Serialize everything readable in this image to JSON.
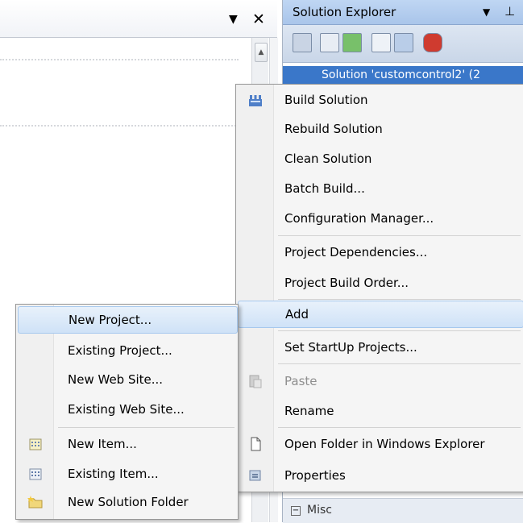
{
  "solution_explorer": {
    "title": "Solution Explorer",
    "tree_root_label": "Solution 'customcontrol2' (2",
    "bottom_section_label": "Misc"
  },
  "context_menu": {
    "items": [
      {
        "label": "Build Solution",
        "icon": "build-solution-icon"
      },
      {
        "label": "Rebuild Solution"
      },
      {
        "label": "Clean Solution"
      },
      {
        "label": "Batch Build..."
      },
      {
        "label": "Configuration Manager..."
      },
      {
        "label": "Project Dependencies..."
      },
      {
        "label": "Project Build Order..."
      },
      {
        "label": "Add",
        "highlighted": true
      },
      {
        "label": "Set StartUp Projects..."
      },
      {
        "label": "Paste",
        "disabled": true,
        "icon": "paste-icon"
      },
      {
        "label": "Rename"
      },
      {
        "label": "Open Folder in Windows Explorer",
        "icon": "open-folder-icon"
      },
      {
        "label": "Properties",
        "icon": "properties-icon"
      }
    ]
  },
  "add_submenu": {
    "items": [
      {
        "label": "New Project...",
        "highlighted": true
      },
      {
        "label": "Existing Project..."
      },
      {
        "label": "New Web Site..."
      },
      {
        "label": "Existing Web Site..."
      },
      {
        "label": "New Item...",
        "icon": "new-item-icon"
      },
      {
        "label": "Existing Item...",
        "icon": "existing-item-icon"
      },
      {
        "label": "New Solution Folder",
        "icon": "new-solution-folder-icon"
      }
    ]
  },
  "colors": {
    "highlight": "#cfe2f7",
    "selection": "#3a77c9",
    "title_bar": "#bfd6f3"
  }
}
